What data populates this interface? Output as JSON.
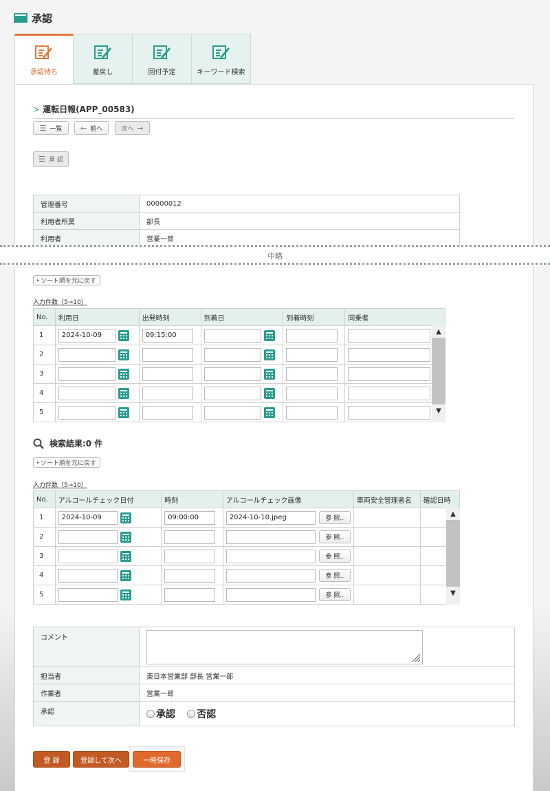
{
  "page_title": "承認",
  "tabs": [
    {
      "label": "承認待ち",
      "active": true
    },
    {
      "label": "差戻し"
    },
    {
      "label": "回付予定"
    },
    {
      "label": "キーワード検索"
    }
  ],
  "record": {
    "title": "運転日報(APP_00583)",
    "nav": {
      "list": "一覧",
      "prev": "前へ",
      "next": "次へ"
    },
    "approve_button": "承 認"
  },
  "info": [
    {
      "label": "管理番号",
      "value": "00000012"
    },
    {
      "label": "利用者所属",
      "value": "部長"
    },
    {
      "label": "利用者",
      "value": "営業一郎"
    }
  ],
  "divider_text": "中略",
  "grid1": {
    "sort_reset": "ソート順を元に戻す",
    "count_link": "入力件数（5→10）",
    "headers": [
      "No.",
      "利用日",
      "出発時刻",
      "到着日",
      "到着時刻",
      "同乗者"
    ],
    "rows": [
      {
        "no": "1",
        "date": "2024-10-09",
        "depart": "09:15:00",
        "arrive_date": "",
        "arrive_time": "",
        "companion": ""
      },
      {
        "no": "2",
        "date": "",
        "depart": "",
        "arrive_date": "",
        "arrive_time": "",
        "companion": ""
      },
      {
        "no": "3",
        "date": "",
        "depart": "",
        "arrive_date": "",
        "arrive_time": "",
        "companion": ""
      },
      {
        "no": "4",
        "date": "",
        "depart": "",
        "arrive_date": "",
        "arrive_time": "",
        "companion": ""
      },
      {
        "no": "5",
        "date": "",
        "depart": "",
        "arrive_date": "",
        "arrive_time": "",
        "companion": ""
      }
    ]
  },
  "search": {
    "title": "検索結果:0 件"
  },
  "grid2": {
    "sort_reset": "ソート順を元に戻す",
    "count_link": "入力件数（5→10）",
    "headers": [
      "No.",
      "アルコールチェック日付",
      "時刻",
      "アルコールチェック画像",
      "車両安全管理者名",
      "確認日時"
    ],
    "ref_label": "参 照..",
    "rows": [
      {
        "no": "1",
        "date": "2024-10-09",
        "time": "09:00:00",
        "image": "2024-10-10.jpeg"
      },
      {
        "no": "2",
        "date": "",
        "time": "",
        "image": ""
      },
      {
        "no": "3",
        "date": "",
        "time": "",
        "image": ""
      },
      {
        "no": "4",
        "date": "",
        "time": "",
        "image": ""
      },
      {
        "no": "5",
        "date": "",
        "time": "",
        "image": ""
      }
    ]
  },
  "form": {
    "comment_label": "コメント",
    "comment_value": "",
    "owner_label": "担当者",
    "owner_value": "東日本営業部 部長 営業一郎",
    "worker_label": "作業者",
    "worker_value": "営業一郎",
    "approval_label": "承認",
    "approve_option": "承認",
    "reject_option": "否認"
  },
  "actions": {
    "register": "登 録",
    "register_next": "登録して次へ",
    "temp_save": "一時保存"
  },
  "colors": {
    "accent": "#e07a3a",
    "teal": "#2a9d8f",
    "action_dark": "#c25a24",
    "action_light": "#e06a2c"
  }
}
